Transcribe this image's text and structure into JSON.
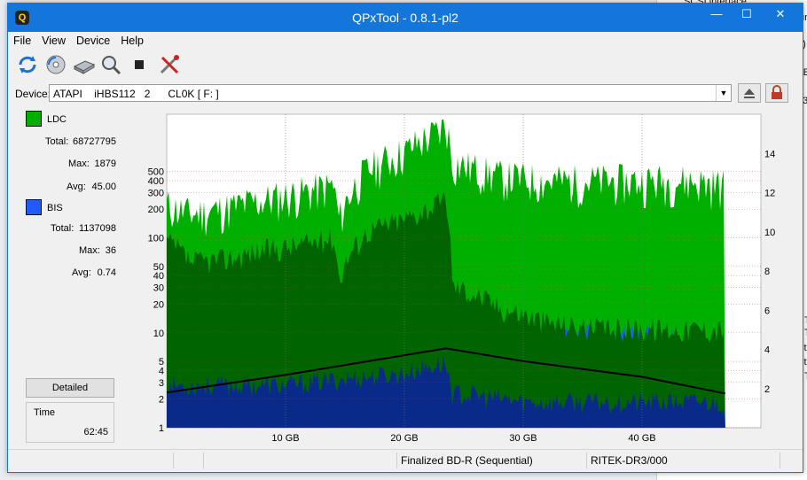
{
  "window": {
    "title": "QPxTool - 0.8.1-pl2",
    "icon_letter": "Q"
  },
  "background_fragments": [
    "SCSI interface",
    "ur",
    "0)",
    "TE",
    "13",
    "T",
    "T",
    "st",
    "st",
    "T"
  ],
  "menu": [
    "File",
    "View",
    "Device",
    "Help"
  ],
  "toolbar_icons": [
    "refresh-icon",
    "disc-scan-icon",
    "drive-icon",
    "zoom-icon",
    "stop-icon",
    "tools-icon"
  ],
  "device": {
    "label": "Device:",
    "value": "ATAPI    iHBS112   2      CL0K [ F: ]"
  },
  "legend": {
    "ldc": {
      "name": "LDC",
      "color": "#00b000",
      "total_label": "Total:",
      "total": "68727795",
      "max_label": "Max:",
      "max": "1879",
      "avg_label": "Avg:",
      "avg": "45.00"
    },
    "bis": {
      "name": "BIS",
      "color": "#1e5cff",
      "total_label": "Total:",
      "total": "1137098",
      "max_label": "Max:",
      "max": "36",
      "avg_label": "Avg:",
      "avg": "0.74"
    }
  },
  "detailed_button": "Detailed",
  "time": {
    "label": "Time",
    "value": "62:45"
  },
  "status": {
    "cell1": "",
    "cell2": "",
    "disc_type": "Finalized BD-R (Sequential)",
    "media_id": "RITEK-DR3/000"
  },
  "chart_data": {
    "type": "area",
    "x_unit": "GB",
    "xlim": [
      0,
      50
    ],
    "x_ticks": [
      10,
      20,
      30,
      40
    ],
    "x_tick_labels": [
      "10 GB",
      "20 GB",
      "30 GB",
      "40 GB"
    ],
    "y_left_scale": "log",
    "ylim_left": [
      1,
      2000
    ],
    "y_left_ticks": [
      1,
      2,
      3,
      4,
      5,
      10,
      20,
      30,
      40,
      50,
      100,
      200,
      300,
      400,
      500
    ],
    "y_right_ticks": [
      2,
      4,
      6,
      8,
      10,
      12,
      14
    ],
    "ylim_right": [
      0,
      16
    ],
    "grid": true,
    "series": [
      {
        "name": "LDC",
        "color": "#00b000",
        "x": [
          0,
          2,
          5,
          8,
          11,
          14,
          14.5,
          17,
          20,
          23,
          23.5,
          24,
          28,
          32,
          36,
          40,
          44,
          47
        ],
        "peak": [
          250,
          200,
          230,
          280,
          330,
          400,
          170,
          600,
          900,
          1500,
          1800,
          700,
          500,
          450,
          450,
          450,
          450,
          400
        ],
        "avg": [
          100,
          60,
          65,
          80,
          90,
          110,
          40,
          130,
          170,
          250,
          280,
          35,
          20,
          14,
          12,
          12,
          12,
          12
        ],
        "low": [
          40,
          20,
          25,
          30,
          35,
          45,
          20,
          50,
          60,
          80,
          100,
          8,
          5,
          3,
          3,
          3,
          3,
          3
        ]
      },
      {
        "name": "BIS",
        "color": "#1e5cff",
        "x": [
          0,
          5,
          10,
          15,
          20,
          23,
          23.5,
          24,
          30,
          35,
          40,
          47
        ],
        "peak": [
          12,
          14,
          15,
          17,
          20,
          25,
          30,
          12,
          10,
          10,
          10,
          8
        ],
        "avg": [
          3,
          3,
          3,
          3.5,
          4,
          5,
          5,
          2.5,
          2,
          2,
          2,
          2
        ]
      },
      {
        "name": "Speed",
        "color": "#000000",
        "axis": "right",
        "x": [
          0,
          10,
          20,
          23.5,
          30,
          40,
          47
        ],
        "values": [
          1.8,
          2.7,
          3.7,
          4.05,
          3.4,
          2.6,
          1.75
        ]
      }
    ]
  }
}
